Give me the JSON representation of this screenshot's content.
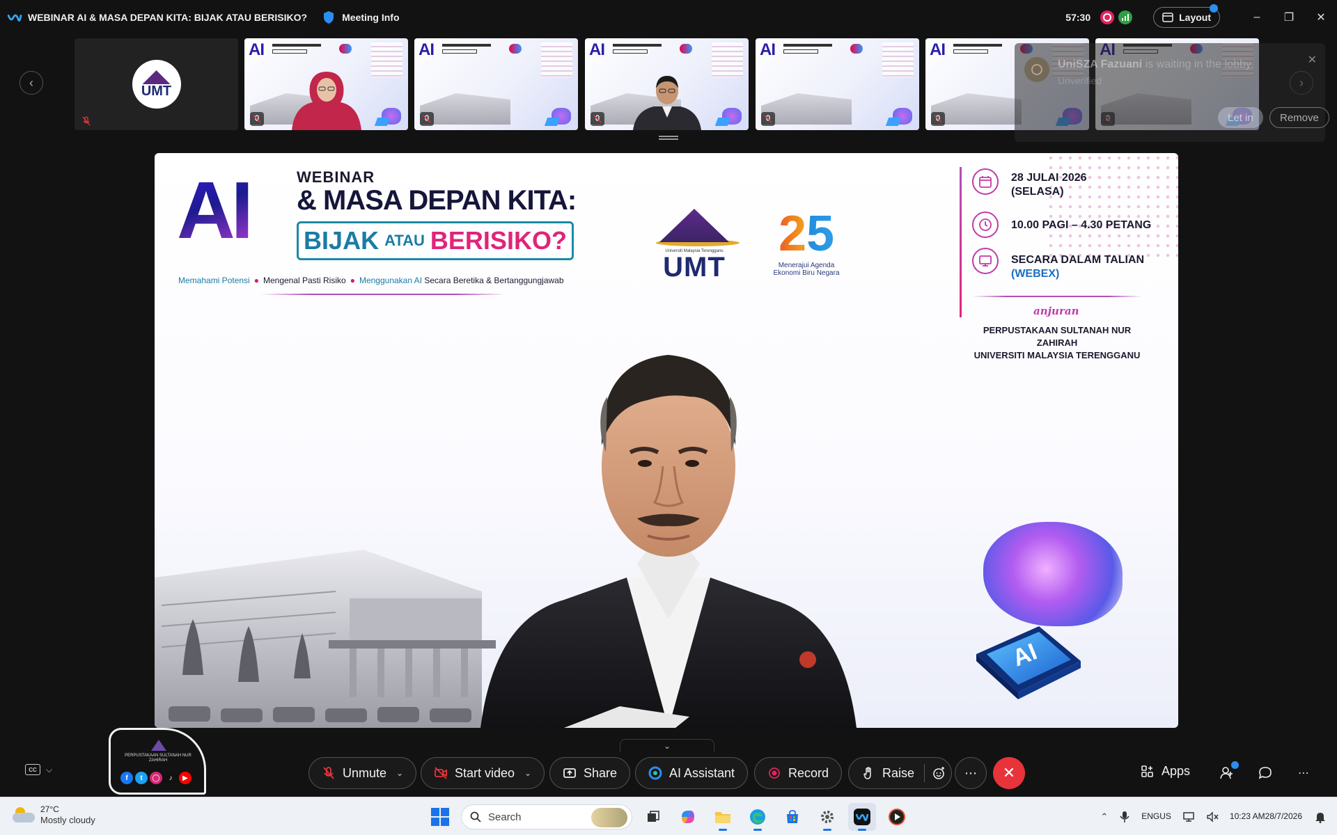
{
  "window": {
    "title": "WEBINAR AI & MASA DEPAN KITA: BIJAK ATAU BERISIKO?",
    "meeting_info": "Meeting Info",
    "timer": "57:30",
    "layout_label": "Layout"
  },
  "strip": {
    "thumb1_logo": "UMT"
  },
  "lobby": {
    "name": "UniSZA Fazuani",
    "message": " is waiting in the lobby.",
    "status": "Unverified",
    "let_in": "Let in",
    "remove": "Remove"
  },
  "slide": {
    "ai": "AI",
    "webinar": "WEBINAR",
    "headline": "& MASA DEPAN KITA:",
    "bijak": "BIJAK",
    "atau": "ATAU",
    "berisiko": "BERISIKO?",
    "tagline": [
      "Memahami Potensi",
      "Mengenal Pasti Risiko",
      "Menggunakan AI",
      "Secara Beretika & Bertanggungjawab"
    ],
    "umt_text": "UMT",
    "umt_sub": "Universiti Malaysia Terengganu",
    "years_num": "25",
    "years_sub": "Menerajui Agenda Ekonomi Biru Negara",
    "date_line1": "28 JULAI 2026",
    "date_line2": "(SELASA)",
    "time": "10.00 PAGI – 4.30 PETANG",
    "venue_line1": "SECARA DALAM TALIAN",
    "venue_line2": "(WEBEX)",
    "anjuran": "anjuran",
    "org_line1": "PERPUSTAKAAN SULTANAH NUR ZAHIRAH",
    "org_line2": "UNIVERSITI MALAYSIA TERENGGANU",
    "chip_label": "AI"
  },
  "pip": {
    "text": "PERPUSTAKAAN SULTANAH NUR ZAHIRAH"
  },
  "controls": {
    "unmute": "Unmute",
    "start_video": "Start video",
    "share": "Share",
    "ai_assistant": "AI Assistant",
    "record": "Record",
    "raise": "Raise",
    "apps": "Apps"
  },
  "taskbar": {
    "temp": "27°C",
    "weather": "Mostly cloudy",
    "search_placeholder": "Search",
    "lang1": "ENG",
    "lang2": "US",
    "time": "10:23 AM",
    "date": "28/7/2026"
  },
  "colors": {
    "end_call": "#e8333b",
    "accent_blue": "#2b8ef0",
    "record_red": "#e0245e"
  }
}
